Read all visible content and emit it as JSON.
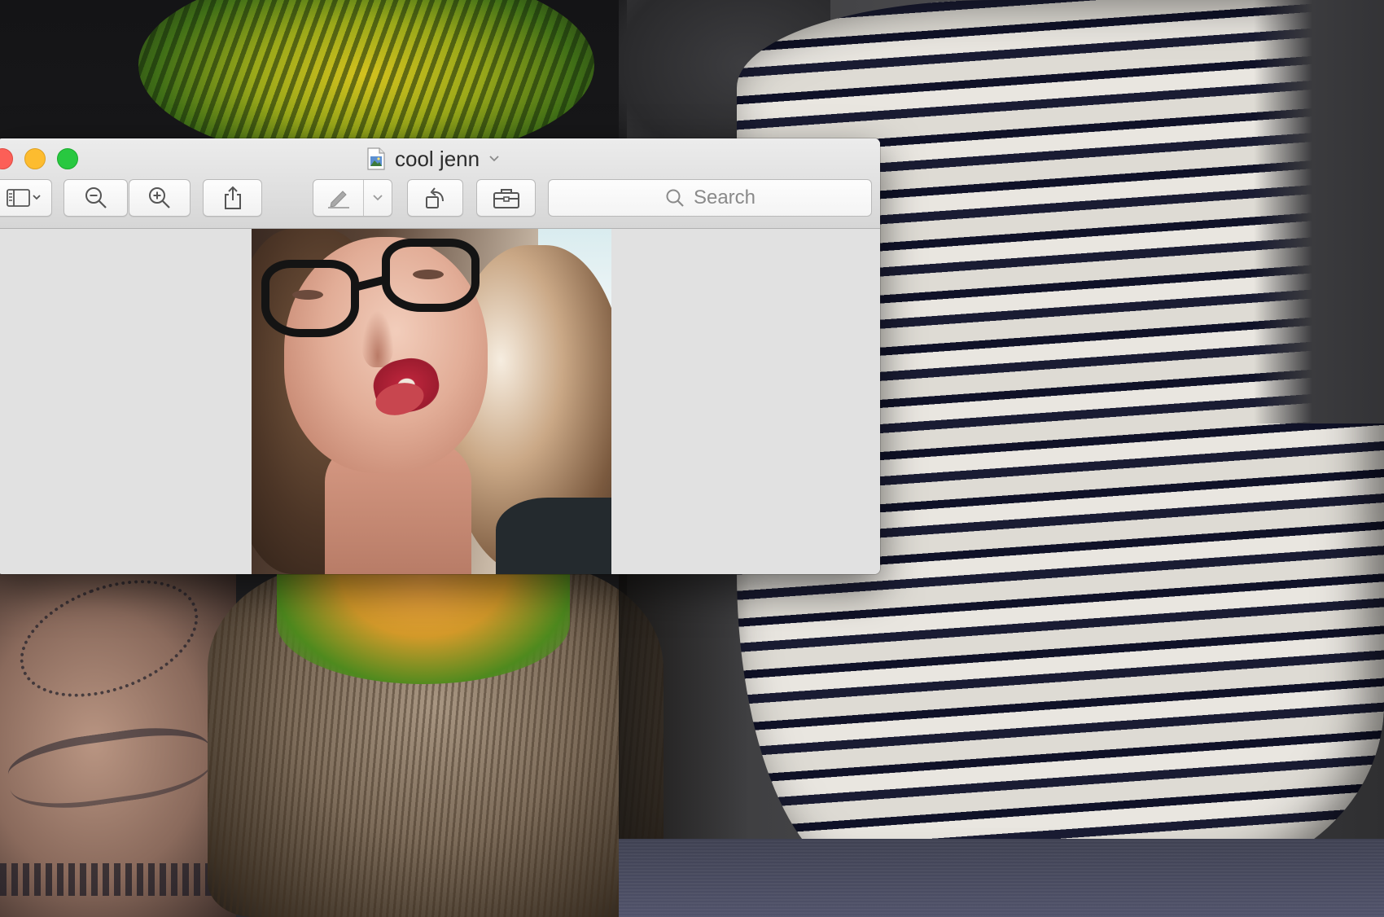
{
  "window": {
    "title": "cool jenn",
    "title_icon": "document-image-icon"
  },
  "toolbar": {
    "sidebar_button": "sidebar-view-icon",
    "zoom_out_button": "zoom-out-icon",
    "zoom_in_button": "zoom-in-icon",
    "share_button": "share-icon",
    "markup_button": "pen-markup-icon",
    "markup_menu_button": "chevron-down-icon",
    "rotate_button": "rotate-left-icon",
    "toolbox_button": "toolbox-icon"
  },
  "search": {
    "placeholder": "Search"
  },
  "colors": {
    "close": "#fc5f57",
    "minimize": "#fdbc2f",
    "maximize": "#28c840"
  }
}
